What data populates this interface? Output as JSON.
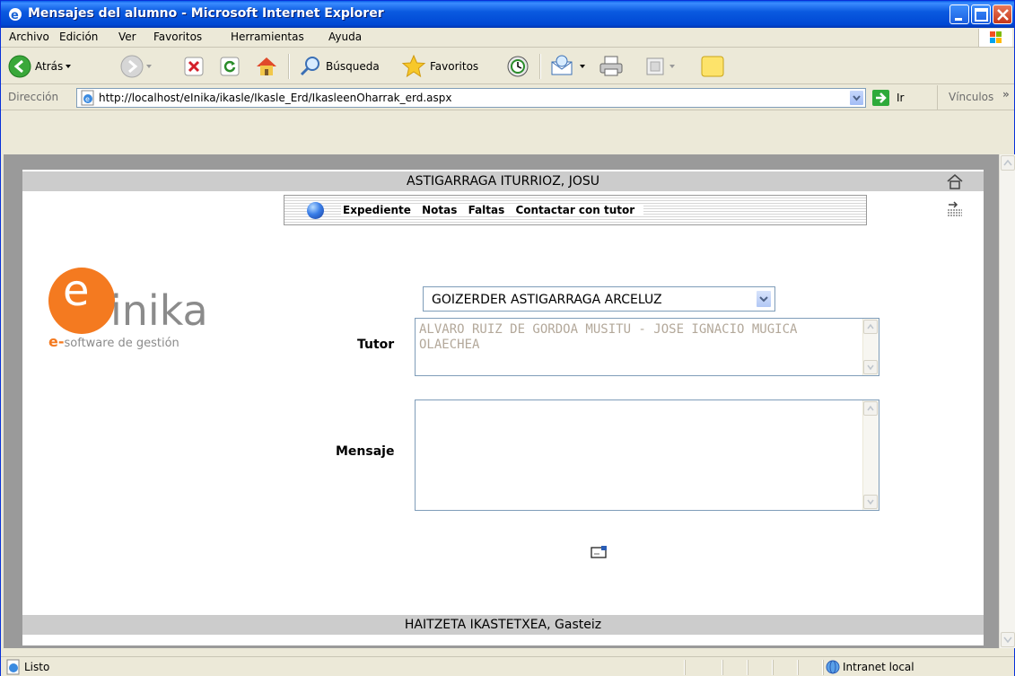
{
  "window": {
    "title": "Mensajes del alumno - Microsoft Internet Explorer"
  },
  "menubar": {
    "items": [
      "Archivo",
      "Edición",
      "Ver",
      "Favoritos",
      "Herramientas",
      "Ayuda"
    ]
  },
  "toolbar": {
    "back_label": "Atrás",
    "search_label": "Búsqueda",
    "favorites_label": "Favoritos"
  },
  "addressbar": {
    "label": "Dirección",
    "url": "http://localhost/eInika/ikasle/Ikasle_Erd/IkasleenOharrak_erd.aspx",
    "go_label": "Ir",
    "links_label": "Vínculos"
  },
  "page": {
    "header_name": "ASTIGARRAGA ITURRIOZ, JOSU",
    "nav": [
      "Expediente",
      "Notas",
      "Faltas",
      "Contactar con tutor"
    ],
    "logo": {
      "brand": "inika",
      "brand_letter": "e",
      "tagline_prefix": "e-",
      "tagline": "software de gestión"
    },
    "form": {
      "student_select_value": "GOIZERDER ASTIGARRAGA ARCELUZ",
      "tutor_label": "Tutor",
      "tutor_value": "ALVARO RUIZ DE GORDOA MUSITU - JOSE IGNACIO MUGICA OLAECHEA",
      "message_label": "Mensaje",
      "message_value": ""
    },
    "footer": "HAITZETA IKASTETXEA, Gasteiz"
  },
  "statusbar": {
    "status": "Listo",
    "zone": "Intranet local"
  },
  "colors": {
    "accent": "#f47a20",
    "band": "#cccccc",
    "titlebar": "#0a5ae0"
  }
}
